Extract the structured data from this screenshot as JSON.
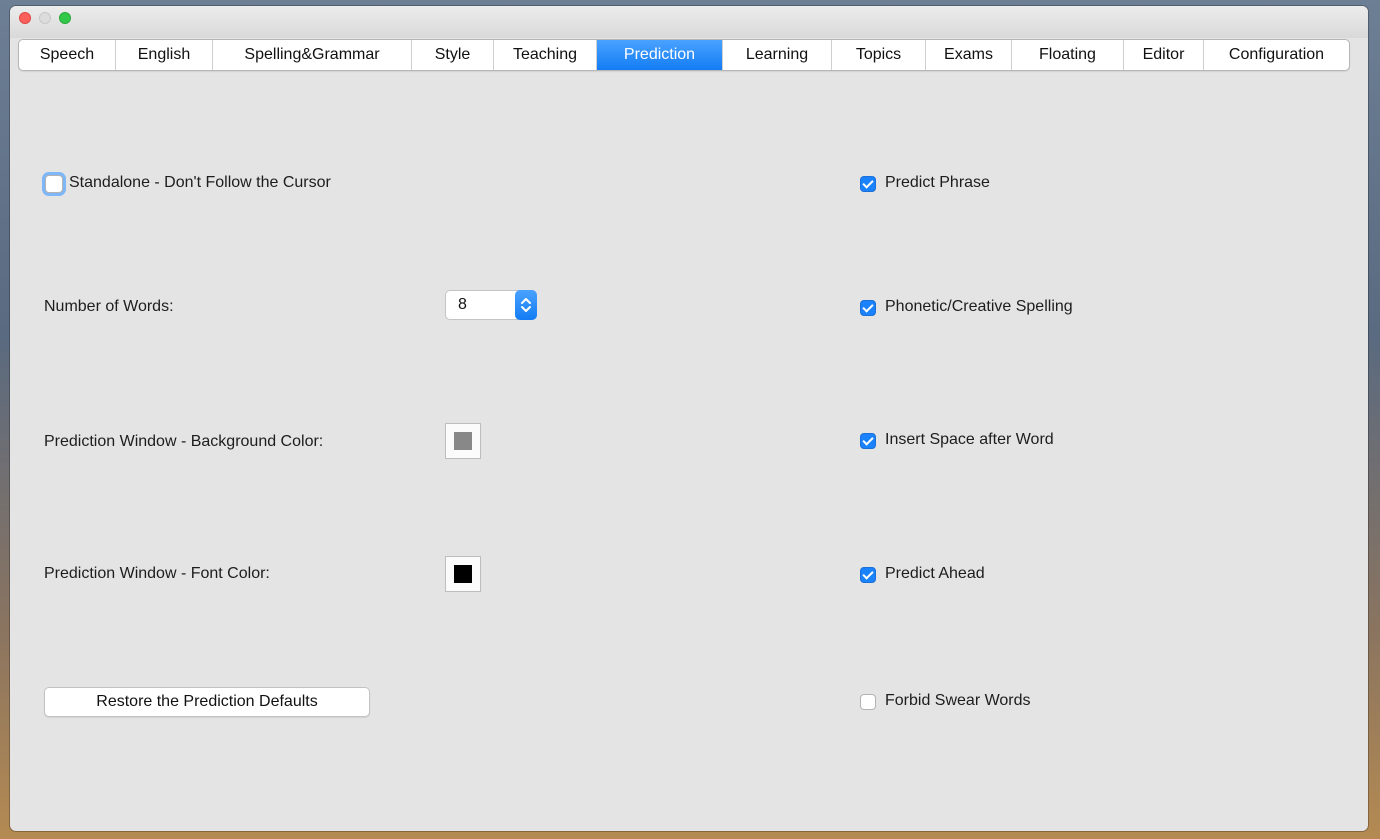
{
  "tabs": [
    "Speech",
    "English",
    "Spelling&Grammar",
    "Style",
    "Teaching",
    "Prediction",
    "Learning",
    "Topics",
    "Exams",
    "Floating",
    "Editor",
    "Configuration"
  ],
  "active_tab": "Prediction",
  "colors": {
    "accent": "#1a82fb",
    "background_color_swatch": "#888888",
    "font_color_swatch": "#000000"
  },
  "left": {
    "standalone": {
      "label": "Standalone - Don't Follow the Cursor",
      "checked": false
    },
    "number_of_words": {
      "label": "Number of Words:",
      "value": "8"
    },
    "background_color_label": "Prediction Window - Background Color:",
    "font_color_label": "Prediction Window - Font Color:",
    "restore_button": "Restore the Prediction Defaults"
  },
  "right": {
    "predict_phrase": {
      "label": "Predict Phrase",
      "checked": true
    },
    "phonetic_spelling": {
      "label": "Phonetic/Creative Spelling",
      "checked": true
    },
    "insert_space": {
      "label": "Insert Space after Word",
      "checked": true
    },
    "predict_ahead": {
      "label": "Predict Ahead",
      "checked": true
    },
    "forbid_swear": {
      "label": "Forbid Swear Words",
      "checked": false
    }
  }
}
